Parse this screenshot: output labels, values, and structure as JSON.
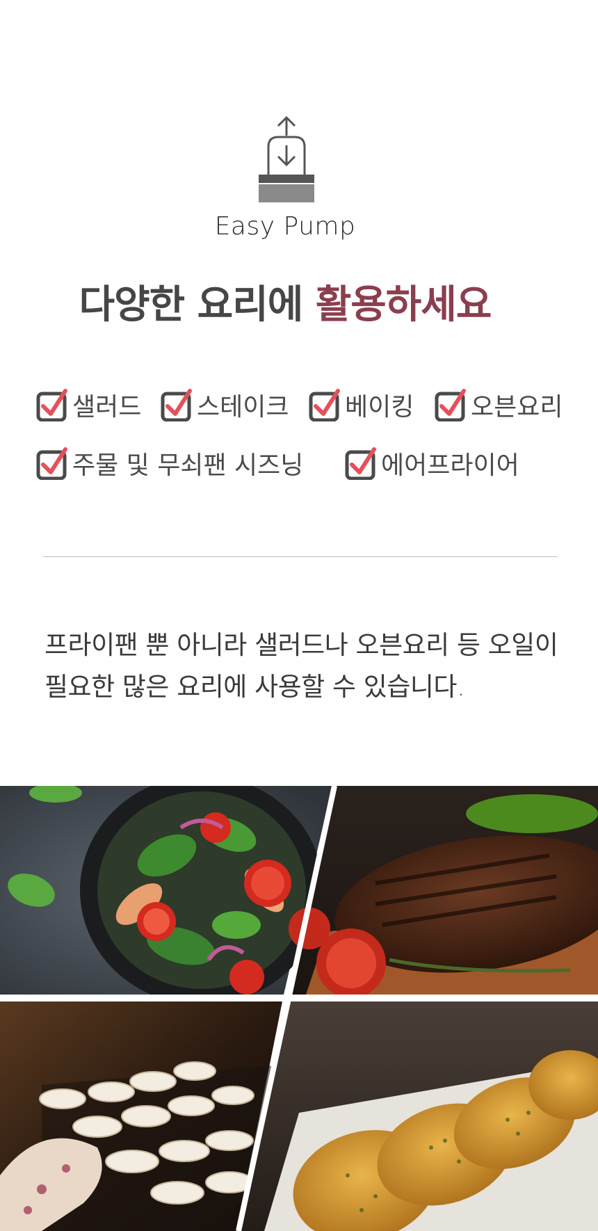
{
  "feature": {
    "icon": "pump-icon",
    "label": "Easy Pump"
  },
  "headline": {
    "part1": "다양한 요리에",
    "part2": "활용하세요",
    "accent_color": "#8a3f4e"
  },
  "checklist": [
    {
      "label": "샐러드",
      "checked": true
    },
    {
      "label": "스테이크",
      "checked": true
    },
    {
      "label": "베이킹",
      "checked": true
    },
    {
      "label": "오븐요리",
      "checked": true
    },
    {
      "label": "주물 및 무쇠팬 시즈닝",
      "checked": true
    },
    {
      "label": "에어프라이어",
      "checked": true
    }
  ],
  "description": {
    "line1": "프라이팬 뿐 아니라 샐러드나 오븐요리 등 오일이",
    "line2": "필요한 많은 요리에 사용할 수 있습니다."
  },
  "photos": [
    {
      "name": "salad-photo"
    },
    {
      "name": "steak-photo"
    },
    {
      "name": "baking-photo"
    },
    {
      "name": "garlic-bread-photo"
    }
  ],
  "colors": {
    "check_mark": "#e5505a",
    "check_box": "#4a4a4a",
    "text": "#464646"
  }
}
